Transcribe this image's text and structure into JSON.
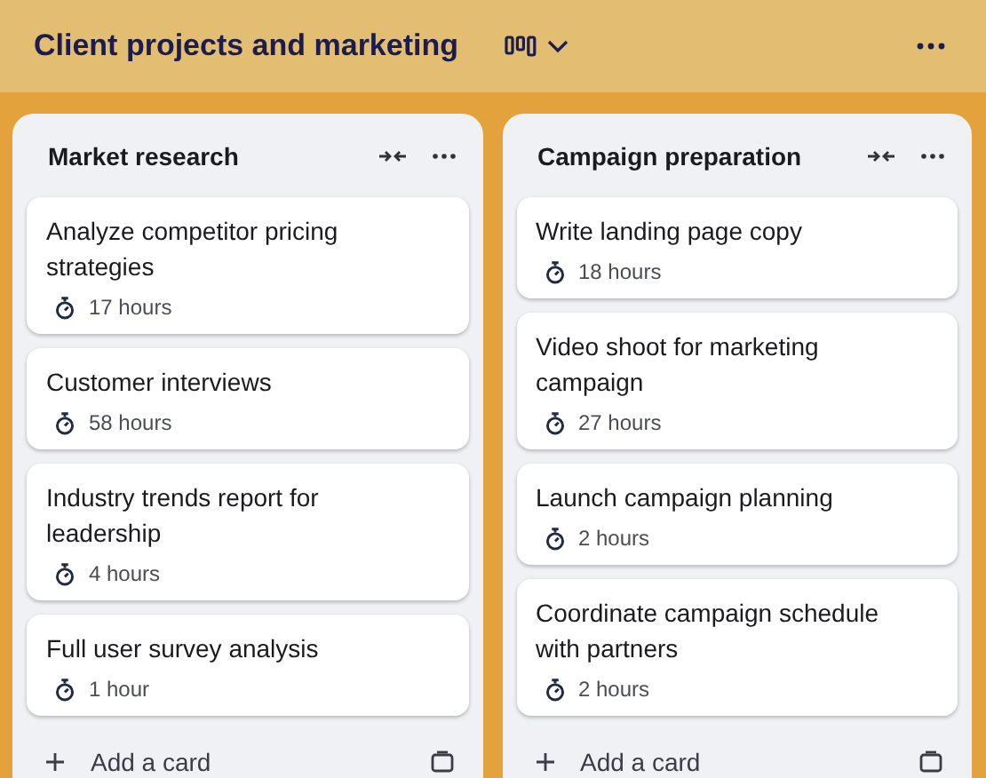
{
  "board": {
    "title": "Client projects and marketing"
  },
  "lists": [
    {
      "title": "Market research",
      "cards": [
        {
          "title": "Analyze competitor pricing strategies",
          "estimate": "17 hours"
        },
        {
          "title": "Customer interviews",
          "estimate": "58 hours"
        },
        {
          "title": "Industry trends report for leadership",
          "estimate": "4 hours"
        },
        {
          "title": "Full user survey analysis",
          "estimate": "1 hour"
        }
      ],
      "add_label": "Add a card"
    },
    {
      "title": "Campaign preparation",
      "cards": [
        {
          "title": "Write landing page copy",
          "estimate": "18 hours"
        },
        {
          "title": "Video shoot for marketing campaign",
          "estimate": "27 hours"
        },
        {
          "title": "Launch campaign planning",
          "estimate": "2 hours"
        },
        {
          "title": "Coordinate campaign schedule with partners",
          "estimate": "2 hours"
        }
      ],
      "add_label": "Add a card"
    }
  ]
}
